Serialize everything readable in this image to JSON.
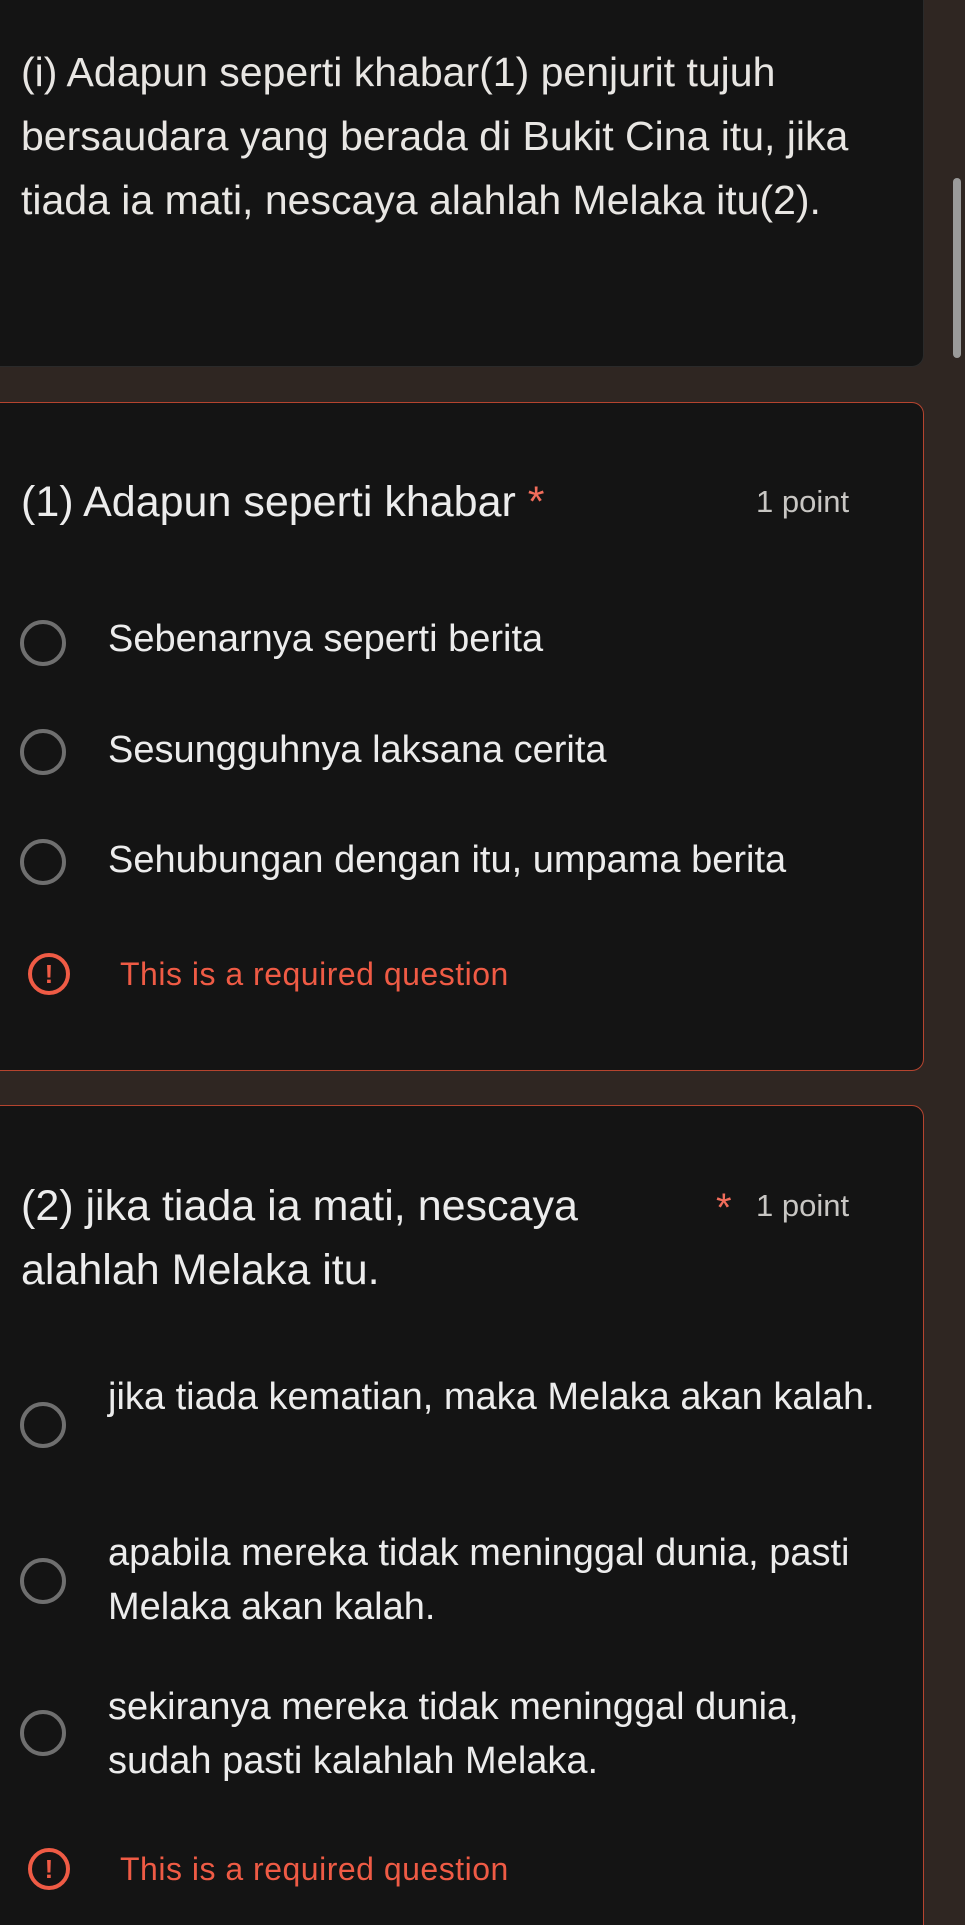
{
  "intro": {
    "text": "(i) Adapun seperti khabar(1) penjurit tujuh bersaudara yang berada di Bukit Cina itu, jika tiada ia mati, nescaya alahlah Melaka itu(2)."
  },
  "questions": [
    {
      "title": "(1) Adapun seperti khabar",
      "required_mark": "*",
      "points": "1 point",
      "options": [
        "Sebenarnya seperti berita",
        "Sesungguhnya laksana cerita",
        "Sehubungan dengan itu, umpama berita"
      ],
      "error": "This is a required question"
    },
    {
      "title": "(2) jika tiada ia mati, nescaya alahlah Melaka itu.",
      "required_mark": "*",
      "points": "1 point",
      "options": [
        "jika tiada kematian, maka Melaka akan kalah.",
        "apabila mereka tidak meninggal dunia, pasti Melaka akan kalah.",
        "sekiranya mereka tidak meninggal dunia, sudah pasti kalahlah Melaka."
      ],
      "error": "This is a required question"
    }
  ],
  "icons": {
    "error": "error-circle-icon",
    "radio": "radio-unchecked-icon"
  },
  "colors": {
    "background": "#2f2622",
    "card": "#141414",
    "error": "#ef5b45",
    "required": "#f26d5b"
  }
}
